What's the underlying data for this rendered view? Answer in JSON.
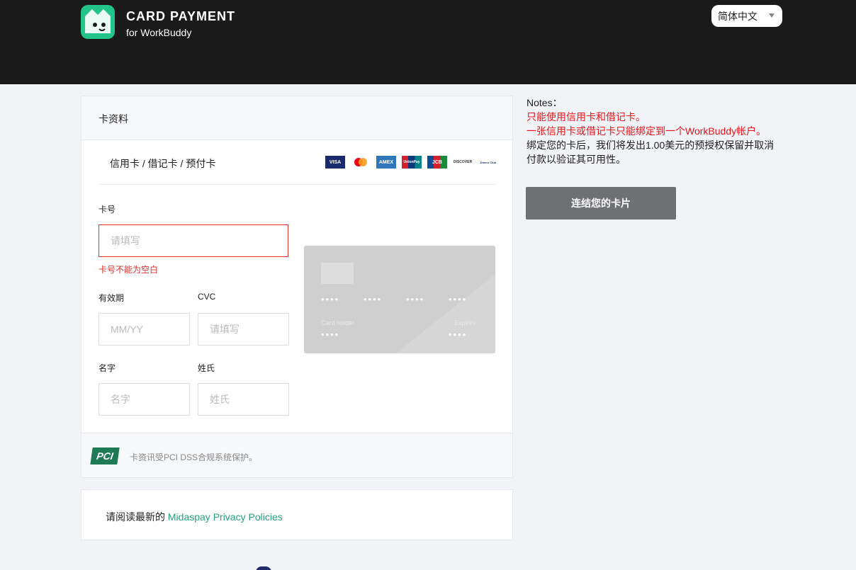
{
  "header": {
    "title": "CARD PAYMENT",
    "subtitle": "for WorkBuddy",
    "language": "简体中文"
  },
  "card_panel": {
    "heading": "卡资料",
    "card_types": "信用卡 / 借记卡 / 预付卡",
    "brands": [
      "VISA",
      "MC",
      "AMEX",
      "UnionPay",
      "JCB",
      "DISCOVER",
      "Diners Club"
    ],
    "card_number": {
      "label": "卡号",
      "placeholder": "请填写",
      "error": "卡号不能为空白"
    },
    "expiry": {
      "label": "有效期",
      "placeholder": "MM/YY"
    },
    "cvc": {
      "label": "CVC",
      "placeholder": "请填写"
    },
    "first_name": {
      "label": "名字",
      "placeholder": "名字"
    },
    "last_name": {
      "label": "姓氏",
      "placeholder": "姓氏"
    },
    "card_preview": {
      "number_groups": [
        "••••",
        "••••",
        "••••",
        "••••"
      ],
      "holder_label": "Card holder",
      "holder_value": "••••",
      "expires_label": "Expires",
      "expires_value": "••••"
    },
    "pci_logo": "PCI",
    "pci_text": "卡资讯受PCI DSS合规系统保护。"
  },
  "privacy": {
    "prefix": "请阅读最新的 ",
    "link": "Midaspay Privacy Policies"
  },
  "notes": {
    "title": "Notes：",
    "line1": "只能使用信用卡和借记卡。",
    "line2": "一张信用卡或借记卡只能绑定到一个WorkBuddy帐户。",
    "line3": "绑定您的卡后，我们将发出1.00美元的预授权保留并取消付款以验证其可用性。"
  },
  "connect_button": "连结您的卡片",
  "colors": {
    "header_bg": "#1a1a1b",
    "brand_green": "#22c48a",
    "error_red": "#e03131",
    "notes_red": "#e8141a",
    "link_green": "#27a57a",
    "button_gray": "#6e7073"
  }
}
